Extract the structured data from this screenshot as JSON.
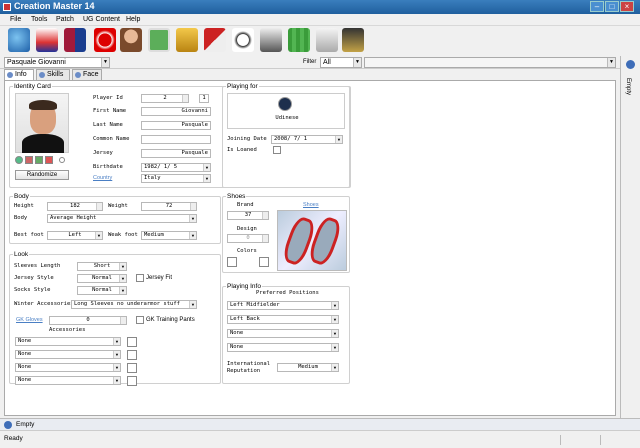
{
  "window": {
    "title": "Creation Master 14"
  },
  "menu": [
    "File",
    "Tools",
    "Patch",
    "UG Content",
    "Help"
  ],
  "toolbar": {
    "player_selector": "Pasquale Giovanni",
    "filter_label": "Filter",
    "filter_value": "All"
  },
  "tabs": [
    {
      "label": "Info"
    },
    {
      "label": "Skills"
    },
    {
      "label": "Face"
    }
  ],
  "identity": {
    "group_label": "Identity Card",
    "randomize_label": "Randomize",
    "player_id_label": "Player Id",
    "player_id_value": "2",
    "player_id_extra": "1",
    "first_name_label": "First Name",
    "first_name_value": "Giovanni",
    "last_name_label": "Last Name",
    "last_name_value": "Pasquale",
    "common_name_label": "Common Name",
    "common_name_value": "",
    "jersey_label": "Jersey",
    "jersey_value": "Pasquale",
    "birthdate_label": "Birthdate",
    "birthdate_value": "1982/ 1/ 5",
    "country_label": "Country",
    "country_value": "Italy"
  },
  "playing_for": {
    "group_label": "Playing for",
    "team": "Udinese",
    "joining_label": "Joining Date",
    "joining_value": "2008/ 7/ 1",
    "loaned_label": "Is Loaned"
  },
  "body": {
    "group_label": "Body",
    "height_label": "Height",
    "height_value": "182",
    "weight_label": "Weight",
    "weight_value": "72",
    "body_label": "Body",
    "body_value": "Average Height",
    "best_foot_label": "Best foot",
    "best_foot_value": "Left",
    "weak_foot_label": "Weak foot",
    "weak_foot_value": "Medium"
  },
  "shoes": {
    "group_label": "Shoes",
    "brand_label": "Brand",
    "brand_value": "37",
    "design_label": "Design",
    "design_value": "0",
    "colors_label": "Colors",
    "shoes_link": "Shoes"
  },
  "look": {
    "group_label": "Look",
    "sleeves_label": "Sleeves Length",
    "sleeves_value": "Short",
    "jersey_style_label": "Jersey Style",
    "jersey_style_value": "Normal",
    "jersey_fit_label": "Jersey Fit",
    "socks_label": "Socks Style",
    "socks_value": "Normal",
    "winter_label": "Winter Accessories",
    "winter_value": "Long Sleeves no underarmor stuff",
    "gk_gloves_label": "GK Gloves",
    "gk_gloves_value": "0",
    "gk_pants_label": "GK Training Pants",
    "accessories_label": "Accessories",
    "accessories": [
      "None",
      "None",
      "None",
      "None"
    ]
  },
  "playing_info": {
    "group_label": "Playing Info",
    "preferred_label": "Preferred Positions",
    "positions": [
      "Left Midfielder",
      "Left Back",
      "None",
      "None"
    ],
    "intl_label": "International Reputation",
    "intl_value": "Medium"
  },
  "right_panel": {
    "label": "Empty"
  },
  "bottom_panel": {
    "label": "Empty"
  },
  "status": {
    "text": "Ready"
  }
}
